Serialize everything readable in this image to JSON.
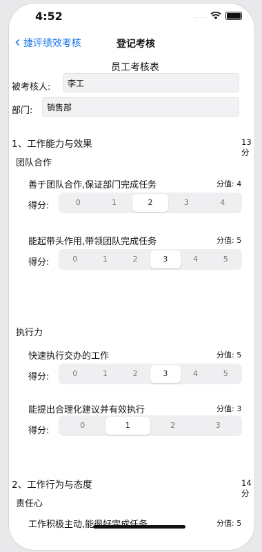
{
  "status_bar": {
    "time": "4:52",
    "dots": "....",
    "wifi_icon": "wifi-icon",
    "battery_icon": "battery-icon"
  },
  "nav": {
    "back_label": "捷评绩效考核",
    "back_icon": "chevron-left-icon",
    "title": "登记考核"
  },
  "form": {
    "title": "员工考核表",
    "assessee_label": "被考核人:",
    "assessee_value": "李工",
    "department_label": "部门:",
    "department_value": "销售部"
  },
  "sections": [
    {
      "title": "1、工作能力与效果",
      "total": "13分",
      "groups": [
        {
          "title": "团队合作",
          "items": [
            {
              "text": "善于团队合作,保证部门完成任务",
              "weight": "分值: 4",
              "score_label": "得分:",
              "options": [
                "0",
                "1",
                "2",
                "3",
                "4"
              ],
              "selected": "2"
            },
            {
              "text": "能起带头作用,带领团队完成任务",
              "weight": "分值: 5",
              "score_label": "得分:",
              "options": [
                "0",
                "1",
                "2",
                "3",
                "4",
                "5"
              ],
              "selected": "3"
            }
          ]
        },
        {
          "title": "执行力",
          "items": [
            {
              "text": "快速执行交办的工作",
              "weight": "分值: 5",
              "score_label": "得分:",
              "options": [
                "0",
                "1",
                "2",
                "3",
                "4",
                "5"
              ],
              "selected": "3"
            },
            {
              "text": "能提出合理化建议并有效执行",
              "weight": "分值: 3",
              "score_label": "得分:",
              "options": [
                "0",
                "1",
                "2",
                "3"
              ],
              "selected": "1"
            }
          ]
        }
      ]
    },
    {
      "title": "2、工作行为与态度",
      "total": "14分",
      "groups": [
        {
          "title": "责任心",
          "items": [
            {
              "text": "工作积极主动,能很好完成任务",
              "weight": "分值: 5"
            }
          ]
        }
      ]
    }
  ],
  "colors": {
    "accent": "#1a73e8",
    "segment_bg": "#efeff2",
    "field_bg": "#f2f2f4"
  }
}
